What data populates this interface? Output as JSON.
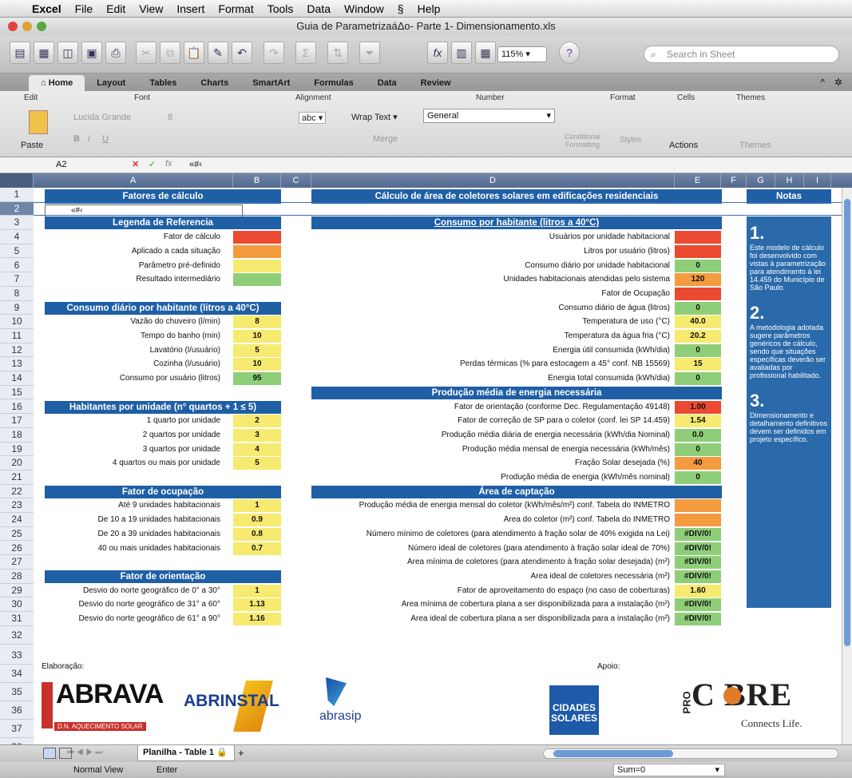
{
  "menubar": {
    "app": "Excel",
    "items": [
      "File",
      "Edit",
      "View",
      "Insert",
      "Format",
      "Tools",
      "Data",
      "Window",
      "Help"
    ]
  },
  "window": {
    "title": "Guia de ParametrizaáΔo- Parte 1- Dimensionamento.xls"
  },
  "toolbar": {
    "zoom": "115%",
    "search_placeholder": "Search in Sheet"
  },
  "ribbon": {
    "tabs": [
      "Home",
      "Layout",
      "Tables",
      "Charts",
      "SmartArt",
      "Formulas",
      "Data",
      "Review"
    ],
    "groups": {
      "edit": "Edit",
      "font": "Font",
      "alignment": "Alignment",
      "number": "Number",
      "format": "Format",
      "cells": "Cells",
      "themes": "Themes"
    },
    "font_name": "Lucida Grande",
    "font_size": "8",
    "wrap_text": "Wrap Text",
    "merge": "Merge",
    "abc": "abc",
    "number_format": "General",
    "paste": "Paste",
    "conditional": "Conditional",
    "formatting": "Formatting",
    "styles": "Styles",
    "actions": "Actions",
    "themes": "Themes"
  },
  "formula_bar": {
    "cell_ref": "A2",
    "content": "«#‹"
  },
  "columns": [
    "A",
    "B",
    "C",
    "D",
    "E",
    "F",
    "G",
    "H",
    "I"
  ],
  "rows": [
    "1",
    "2",
    "3",
    "4",
    "5",
    "6",
    "7",
    "8",
    "9",
    "10",
    "11",
    "12",
    "13",
    "14",
    "15",
    "16",
    "17",
    "18",
    "19",
    "20",
    "21",
    "22",
    "23",
    "24",
    "25",
    "26",
    "27",
    "28",
    "29",
    "30",
    "31",
    "32",
    "33",
    "34",
    "35",
    "36",
    "37",
    "38"
  ],
  "left": {
    "title": "Fatores de cálculo",
    "a2": "«#‹",
    "legend": {
      "header": "Legenda de Referencia",
      "items": [
        "Fator de cálculo",
        "Aplicado a cada situação",
        "Parâmetro pré-definido",
        "Resultado intermediário"
      ]
    },
    "consumo": {
      "header": "Consumo diário por habitante (litros a 40°C)",
      "rows": [
        {
          "label": "Vazão do chuveiro (l/min)",
          "value": "8"
        },
        {
          "label": "Tempo do banho (min)",
          "value": "10"
        },
        {
          "label": "Lavatório (l/usuário)",
          "value": "5"
        },
        {
          "label": "Cozinha (l/usuário)",
          "value": "10"
        },
        {
          "label": "Consumo por usuário (litros)",
          "value": "95"
        }
      ]
    },
    "habitantes": {
      "header": "Habitantes por unidade (n° quartos + 1 ≤ 5)",
      "rows": [
        {
          "label": "1 quarto por unidade",
          "value": "2"
        },
        {
          "label": "2 quartos por unidade",
          "value": "3"
        },
        {
          "label": "3 quartos por unidade",
          "value": "4"
        },
        {
          "label": "4 quartos ou mais por unidade",
          "value": "5"
        }
      ]
    },
    "ocupacao": {
      "header": "Fator de ocupação",
      "rows": [
        {
          "label": "Até 9 unidades habitacionais",
          "value": "1"
        },
        {
          "label": "De 10 a 19 unidades habitacionais",
          "value": "0.9"
        },
        {
          "label": "De 20 a 39 unidades habitacionais",
          "value": "0.8"
        },
        {
          "label": "40 ou mais unidades habitacionais",
          "value": "0.7"
        }
      ]
    },
    "orientacao": {
      "header": "Fator de orientação",
      "rows": [
        {
          "label": "Desvio do norte geográfico de 0° a 30°",
          "value": "1"
        },
        {
          "label": "Desvio do norte geográfico de 31° a 60°",
          "value": "1.13"
        },
        {
          "label": "Desvio do norte geográfico de 61° a 90°",
          "value": "1.16"
        }
      ]
    }
  },
  "main": {
    "title": "Cálculo de área de coletores solares em edificações residenciais",
    "sec1": "Consumo por habitante (litros a 40°C)",
    "sec2": "Produção média de energia necessária",
    "sec3": "Área de captação",
    "rows": [
      {
        "label": "Usuários por unidade habitacional",
        "value": ""
      },
      {
        "label": "Litros por usuário (litros)",
        "value": ""
      },
      {
        "label": "Consumo diário por unidade habitacional",
        "value": "0"
      },
      {
        "label": "Unidades habitacionais atendidas pelo sistema",
        "value": "120"
      },
      {
        "label": "Fator de Ocupação",
        "value": ""
      },
      {
        "label": "Consumo diário de água (litros)",
        "value": "0"
      },
      {
        "label": "Temperatura de uso (°C)",
        "value": "40.0"
      },
      {
        "label": "Temperatura da água fria (°C)",
        "value": "20.2"
      },
      {
        "label": "Energia útil consumida (kWh/dia)",
        "value": "0"
      },
      {
        "label": "Perdas térmicas (% para estocagem a 45° conf. NB 15569)",
        "value": "15"
      },
      {
        "label": "Energia total consumida (kWh/dia)",
        "value": "0"
      },
      {
        "label": "Fator de orientação (conforme Dec. Regulamentação 49148)",
        "value": "1.00"
      },
      {
        "label": "Fator de correção de SP para o coletor (conf. lei SP 14.459)",
        "value": "1.54"
      },
      {
        "label": "Produção média diária de energia necessária (kWh/dia Nominal)",
        "value": "0.0"
      },
      {
        "label": "Produção média mensal de energia necessária (kWh/mês)",
        "value": "0"
      },
      {
        "label": "Fração Solar desejada (%)",
        "value": "40"
      },
      {
        "label": "Produção média de energia (kWh/mês nominal)",
        "value": "0"
      },
      {
        "label": "Produção média de energia mensal do coletor (kWh/mês/m²) conf. Tabela do INMETRO",
        "value": ""
      },
      {
        "label": "Área do coletor (m²) conf. Tabela do INMETRO",
        "value": ""
      },
      {
        "label": "Número mínimo de coletores (para atendimento à fração solar de 40% exigida na Lei)",
        "value": "#DIV/0!"
      },
      {
        "label": "Número ideal de coletores (para atendimento à fração solar ideal de 70%)",
        "value": "#DIV/0!"
      },
      {
        "label": "Área mínima de coletores (para atendimento à fração solar desejada) (m²)",
        "value": "#DIV/0!"
      },
      {
        "label": "Área ideal de coletores necessária (m²)",
        "value": "#DIV/0!"
      },
      {
        "label": "Fator de aproveitamento do espaço (no caso de coberturas)",
        "value": "1.60"
      },
      {
        "label": "Área mínima de cobertura plana a ser disponibilizada para a instalação (m²)",
        "value": "#DIV/0!"
      },
      {
        "label": "Área ideal de cobertura plana a ser disponibilizada para a instalação (m²)",
        "value": "#DIV/0!"
      }
    ]
  },
  "notes": {
    "header": "Notas",
    "items": [
      {
        "num": "1.",
        "text": "Este modelo de cálculo foi desenvolvido com vistas à parametrização para atendimento à lei 14.459 do Município de São Paulo."
      },
      {
        "num": "2.",
        "text": "A metodologia adotada sugere parâmetros genéricos de cálculo, sendo que situações específicas deverão ser avaliadas por profissional habilitado."
      },
      {
        "num": "3.",
        "text": "Dimensionamento e detalhamento definitivos devem ser definidos em projeto específico."
      }
    ]
  },
  "footer": {
    "elaboracao": "Elaboração:",
    "apoio": "Apoio:",
    "abrava": "ABRAVA",
    "abrava_sub": "D.N. AQUECIMENTO SOLAR",
    "abrinstal": "ABRINSTAL",
    "abrasip": "abrasip",
    "cidades": "CIDADES",
    "solares": "SOLARES",
    "pro": "PRO",
    "cobre": "C BRE",
    "connects": "Connects Life."
  },
  "sheet": {
    "tab": "Planilha - Table 1",
    "normal_view": "Normal View",
    "mode": "Enter",
    "sum": "Sum=0"
  },
  "colors": {
    "section_blue": "#1f5fa5",
    "fator_calculo": "#ea4a31",
    "aplicado": "#f49a3f",
    "predefinido": "#f6ea70",
    "intermediario": "#8fce79"
  }
}
